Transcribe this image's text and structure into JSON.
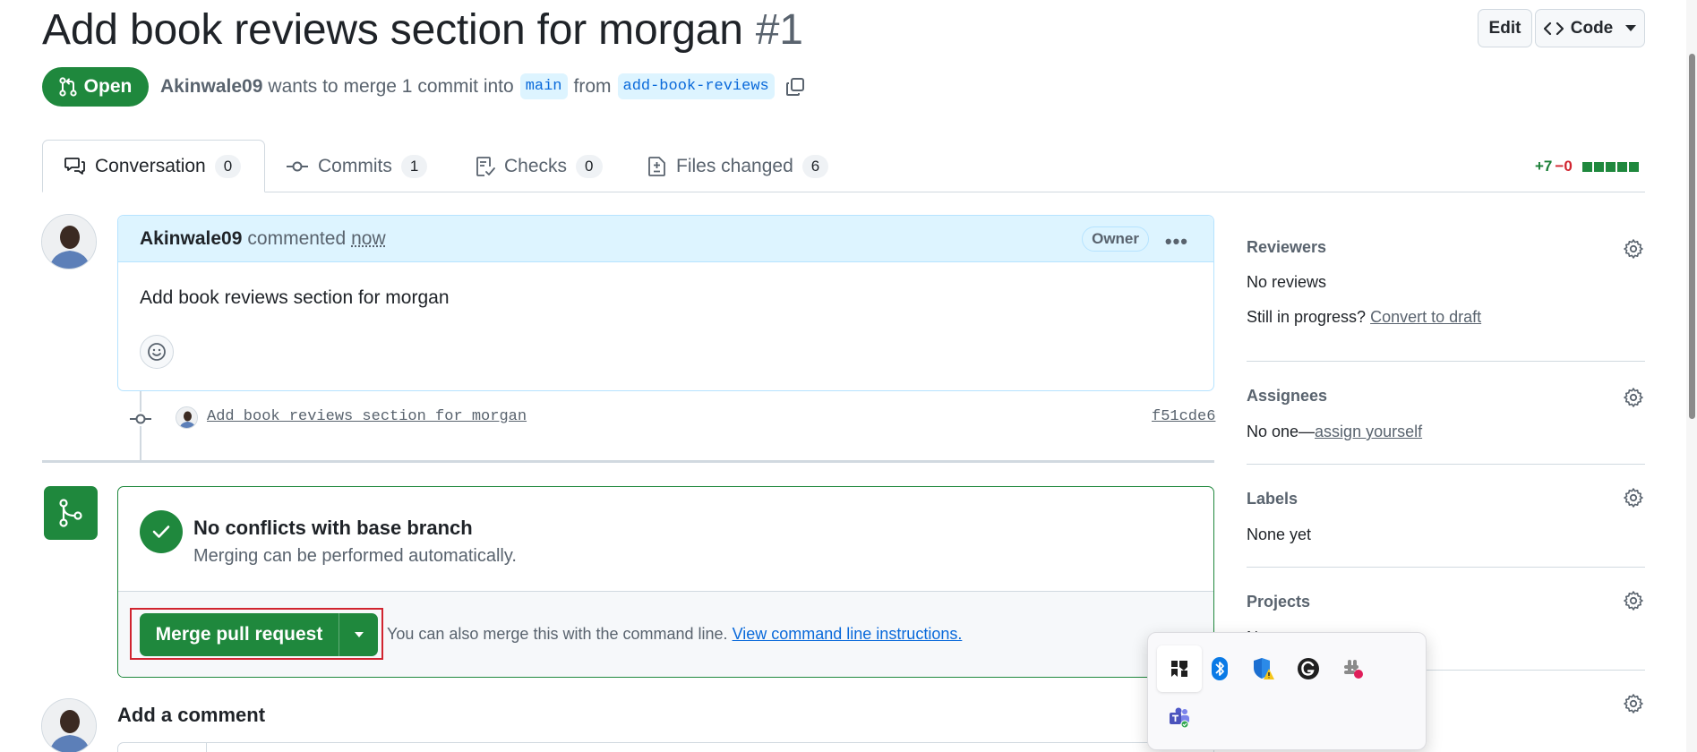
{
  "header": {
    "title": "Add book reviews section for morgan",
    "number": "#1",
    "edit_label": "Edit",
    "code_label": "Code"
  },
  "status": {
    "state": "Open",
    "author": "Akinwale09",
    "wants_to_merge": "wants to merge 1 commit into",
    "base_branch": "main",
    "from_word": "from",
    "head_branch": "add-book-reviews"
  },
  "tabs": [
    {
      "label": "Conversation",
      "count": "0"
    },
    {
      "label": "Commits",
      "count": "1"
    },
    {
      "label": "Checks",
      "count": "0"
    },
    {
      "label": "Files changed",
      "count": "6"
    }
  ],
  "diffstat": {
    "additions": "+7",
    "deletions": "−0"
  },
  "comment": {
    "author": "Akinwale09",
    "action": "commented",
    "time": "now",
    "role": "Owner",
    "body": "Add book reviews section for morgan"
  },
  "commit": {
    "message": "Add book reviews section for morgan",
    "sha": "f51cde6"
  },
  "merge": {
    "title": "No conflicts with base branch",
    "subtitle": "Merging can be performed automatically.",
    "button_label": "Merge pull request",
    "hint": "You can also merge this with the command line.",
    "hint_link": "View command line instructions."
  },
  "add_comment": {
    "title": "Add a comment"
  },
  "sidebar": {
    "reviewers": {
      "title": "Reviewers",
      "value": "No reviews",
      "progress_prefix": "Still in progress?",
      "progress_link": "Convert to draft"
    },
    "assignees": {
      "title": "Assignees",
      "value_prefix": "No one—",
      "value_link": "assign yourself"
    },
    "labels": {
      "title": "Labels",
      "value": "None yet"
    },
    "projects": {
      "title": "Projects",
      "value": "No"
    }
  },
  "tray": {
    "icons": [
      "widget-icon",
      "bluetooth-icon",
      "security-warning-icon",
      "grammarly-icon",
      "slack-icon",
      "teams-icon"
    ]
  },
  "colors": {
    "green": "#1f883d",
    "blue_link": "#0969da",
    "highlight_red": "#d1242f"
  }
}
